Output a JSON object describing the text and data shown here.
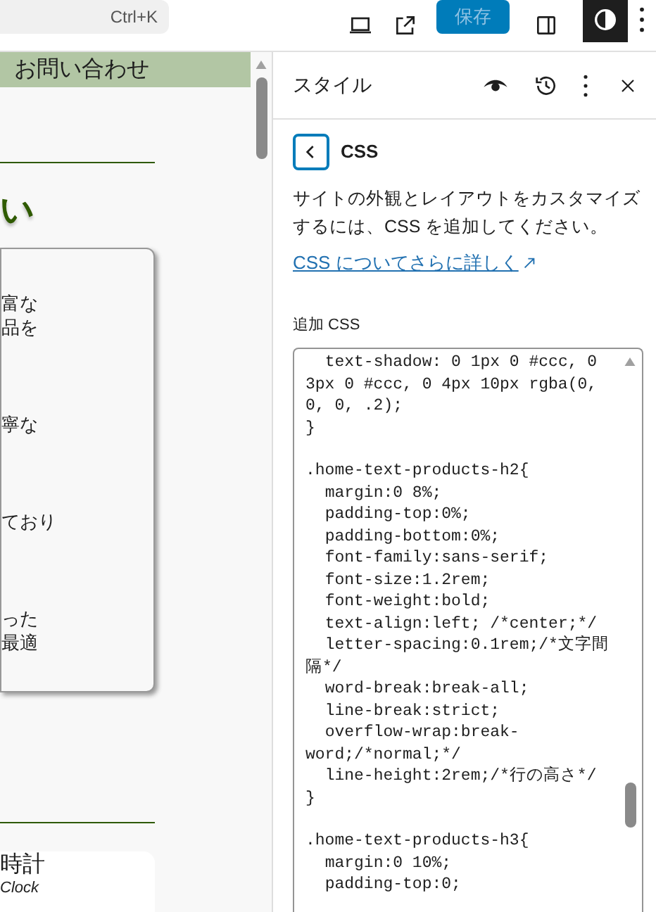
{
  "toolbar": {
    "search_shortcut": "Ctrl+K",
    "save_button": "保存",
    "style_toggle_selected": true
  },
  "canvas": {
    "nav_item": "お問い合わせ",
    "heading": "い",
    "card_lines": [
      [
        "富な",
        "品を"
      ],
      [
        "寧な"
      ],
      [
        "ており"
      ],
      [
        "った",
        "最適"
      ]
    ],
    "product_title": "時計",
    "product_subtitle": "Clock"
  },
  "sidebar": {
    "title": "スタイル",
    "section_title": "CSS",
    "description": "サイトの外観とレイアウトをカスタマイズするには、CSS を追加してください。",
    "link": "CSS についてさらに詳しく",
    "field_label": "追加 CSS",
    "css_blocks": [
      [
        "  text-shadow: 0 1px 0 #ccc, 0 3px 0 #ccc, 0 4px 10px rgba(0, 0, 0, .2);",
        "}"
      ],
      [
        ".home-text-products-h2{",
        "  margin:0 8%;",
        "  padding-top:0%;",
        "  padding-bottom:0%;",
        "  font-family:sans-serif;",
        "  font-size:1.2rem;",
        "  font-weight:bold;",
        "  text-align:left; /*center;*/",
        "  letter-spacing:0.1rem;/*文字間隔*/",
        "  word-break:break-all;",
        "  line-break:strict;",
        "  overflow-wrap:break-word;/*normal;*/",
        "  line-height:2rem;/*行の高さ*/",
        "}"
      ],
      [
        ".home-text-products-h3{",
        "  margin:0 10%;",
        "  padding-top:0;"
      ]
    ]
  }
}
